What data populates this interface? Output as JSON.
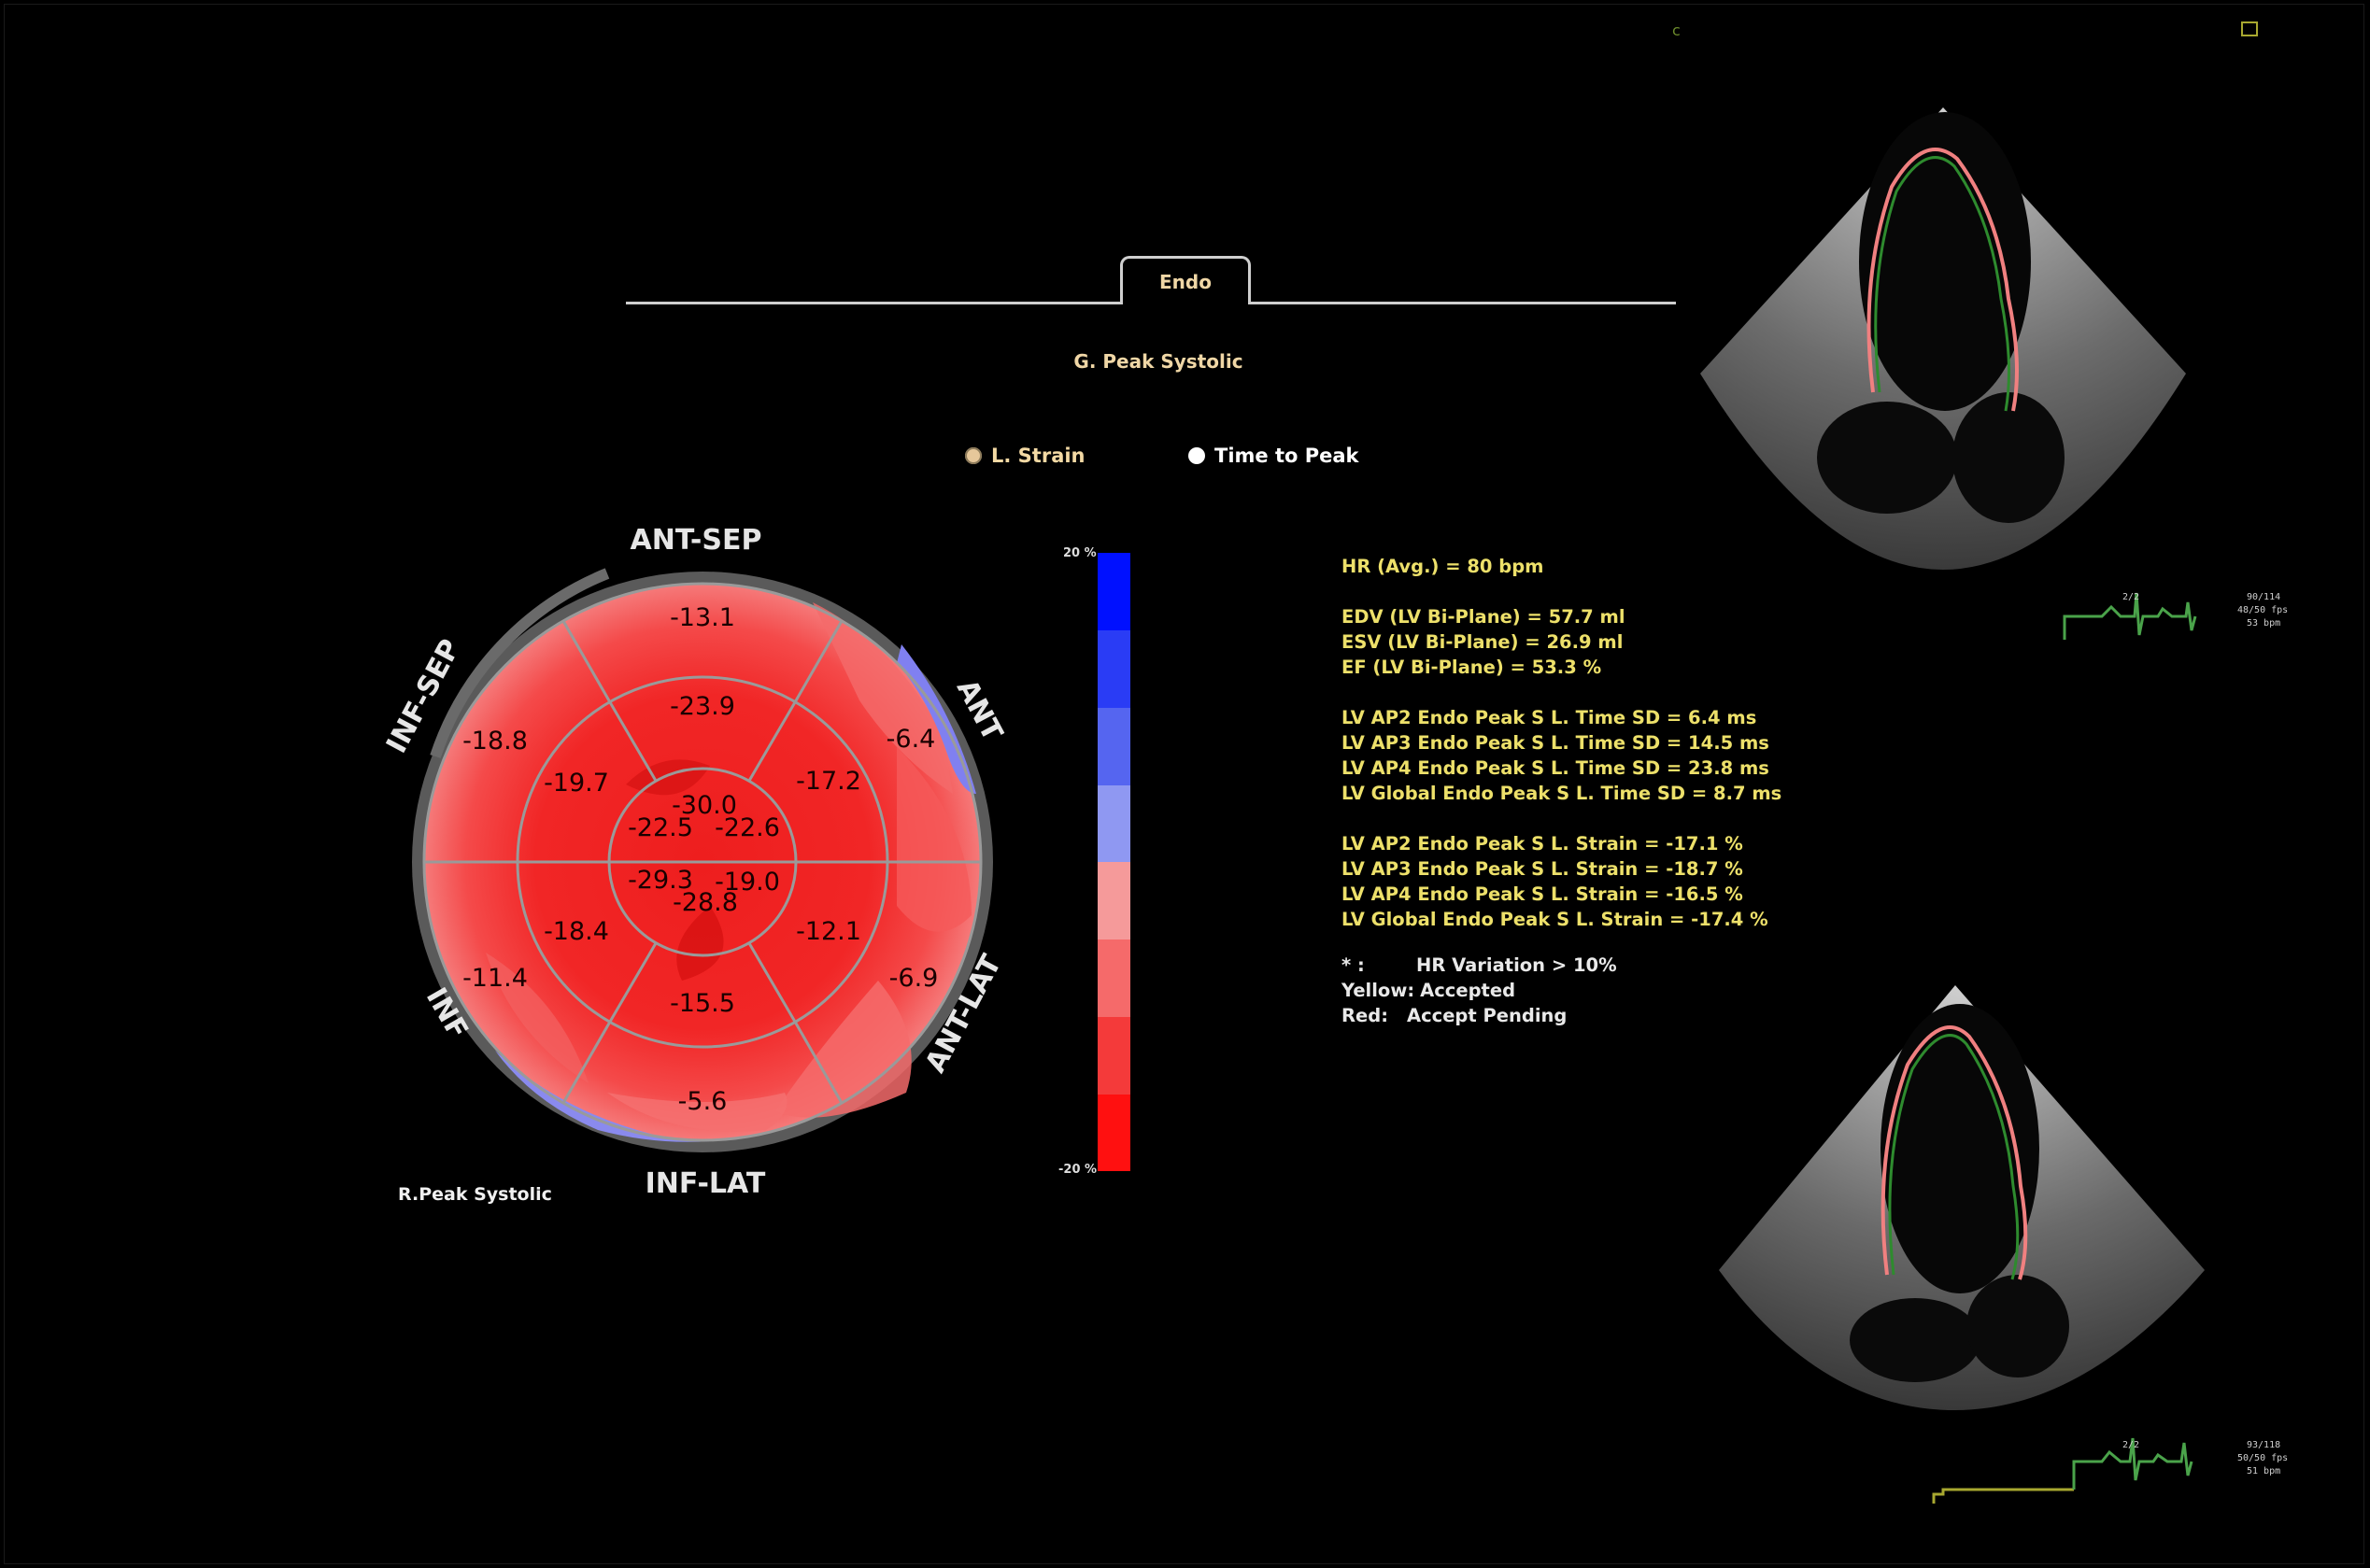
{
  "tab": {
    "label": "Endo"
  },
  "peak_title": "G. Peak Systolic",
  "view_toggle": [
    {
      "label": "L. Strain",
      "selected": true
    },
    {
      "label": "Time to Peak",
      "selected": false
    }
  ],
  "bullseye": {
    "walls": [
      "ANT-SEP",
      "ANT",
      "ANT-LAT",
      "INF-LAT",
      "INF",
      "INF-SEP"
    ],
    "caption": "R.Peak Systolic",
    "basal": [
      "-13.1",
      "-6.4",
      "-6.9",
      "-5.6",
      "-11.4",
      "-18.8"
    ],
    "mid": [
      "-23.9",
      "-17.2",
      "-12.1",
      "-15.5",
      "-18.4",
      "-19.7"
    ],
    "apical": [
      "-30.0",
      "-22.6",
      "-19.0",
      "-28.8",
      "-29.3",
      "-22.5"
    ]
  },
  "scale": {
    "max_label": "20 %",
    "min_label": "-20 %"
  },
  "stats": {
    "hr": "HR (Avg.) = 80 bpm",
    "volumes": [
      "EDV (LV Bi-Plane) = 57.7 ml",
      "ESV (LV Bi-Plane) = 26.9 ml",
      "EF (LV Bi-Plane) = 53.3 %"
    ],
    "time_sd": [
      "LV AP2 Endo Peak S L. Time SD = 6.4 ms",
      "LV AP3 Endo Peak S L. Time SD = 14.5 ms",
      "LV AP4 Endo Peak S L. Time SD = 23.8 ms",
      "LV Global Endo Peak S L. Time SD = 8.7 ms"
    ],
    "strain": [
      "LV AP2 Endo Peak S L. Strain = -17.1 %",
      "LV AP3 Endo Peak S L. Strain = -18.7 %",
      "LV AP4 Endo Peak S L. Strain = -16.5 %",
      "LV Global Endo Peak S L. Strain = -17.4 %"
    ]
  },
  "legend": [
    {
      "key": "* :",
      "value": "HR Variation > 10%"
    },
    {
      "key": "Yellow:",
      "value": "Accepted"
    },
    {
      "key": "Red:",
      "value": "Accept Pending"
    }
  ],
  "echo_top": {
    "frame": "2/2",
    "info": [
      "90/114",
      "48/50 fps",
      "53 bpm"
    ]
  },
  "echo_bottom": {
    "frame": "2/2",
    "info": [
      "93/118",
      "50/50 fps",
      "51 bpm"
    ]
  },
  "colors": {
    "strain_red": "#ff2222",
    "scale_blue": "#0018ff",
    "accepted": "#ede06a",
    "trace_green": "#2e8b2e",
    "trace_pink": "#f08080"
  }
}
